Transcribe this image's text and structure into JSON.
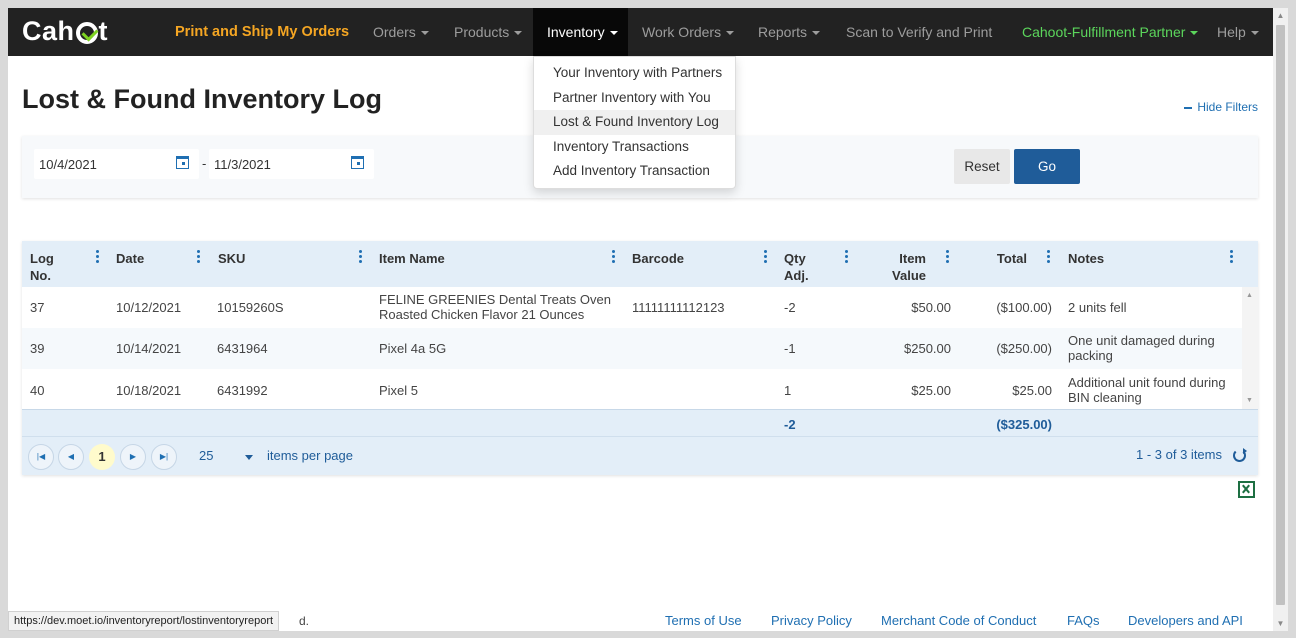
{
  "navbar": {
    "brand": "Cahoot",
    "print_ship": "Print and Ship My Orders",
    "orders": "Orders",
    "products": "Products",
    "inventory": "Inventory",
    "work_orders": "Work Orders",
    "reports": "Reports",
    "scan": "Scan to Verify and Print",
    "partner": "Cahoot-Fulfillment Partner",
    "help": "Help"
  },
  "dropdown": {
    "items": [
      "Your Inventory with Partners",
      "Partner Inventory with You",
      "Lost & Found Inventory Log",
      "Inventory Transactions",
      "Add Inventory Transaction"
    ],
    "selected": "Lost & Found Inventory Log"
  },
  "page": {
    "title": "Lost & Found Inventory Log",
    "hide_filters": "Hide Filters"
  },
  "filters": {
    "start_date": "10/4/2021",
    "end_date": "11/3/2021",
    "separator": "-",
    "reset": "Reset",
    "go": "Go"
  },
  "grid": {
    "headers": {
      "log_no_1": "Log",
      "log_no_2": "No.",
      "date": "Date",
      "sku": "SKU",
      "item_name": "Item Name",
      "barcode": "Barcode",
      "qty_1": "Qty",
      "qty_2": "Adj.",
      "value_1": "Item",
      "value_2": "Value",
      "total": "Total",
      "notes": "Notes"
    },
    "rows": [
      {
        "log_no": "37",
        "date": "10/12/2021",
        "sku": "10159260S",
        "item_name_1": "FELINE GREENIES Dental Treats Oven",
        "item_name_2": "Roasted Chicken Flavor 21 Ounces",
        "barcode": "11111111112123",
        "qty": "-2",
        "value": "$50.00",
        "total": "($100.00)",
        "notes_1": "2 units fell",
        "notes_2": ""
      },
      {
        "log_no": "39",
        "date": "10/14/2021",
        "sku": "6431964",
        "item_name_1": "Pixel 4a 5G",
        "item_name_2": "",
        "barcode": "",
        "qty": "-1",
        "value": "$250.00",
        "total": "($250.00)",
        "notes_1": "One unit damaged during",
        "notes_2": "packing"
      },
      {
        "log_no": "40",
        "date": "10/18/2021",
        "sku": "6431992",
        "item_name_1": "Pixel 5",
        "item_name_2": "",
        "barcode": "",
        "qty": "1",
        "value": "$25.00",
        "total": "$25.00",
        "notes_1": "Additional unit found during",
        "notes_2": "BIN cleaning"
      }
    ],
    "footer": {
      "qty_total": "-2",
      "total": "($325.00)"
    },
    "pager": {
      "current_page": "1",
      "page_size": "25",
      "items_per_page": "items per page",
      "info": "1 - 3 of 3 items"
    }
  },
  "status_bar": {
    "url": "https://dev.moet.io/inventoryreport/lostinventoryreport",
    "tail": "d."
  },
  "footer": {
    "terms": "Terms of Use",
    "privacy": "Privacy Policy",
    "merchant": "Merchant Code of Conduct",
    "faqs": "FAQs",
    "developers": "Developers and API"
  }
}
